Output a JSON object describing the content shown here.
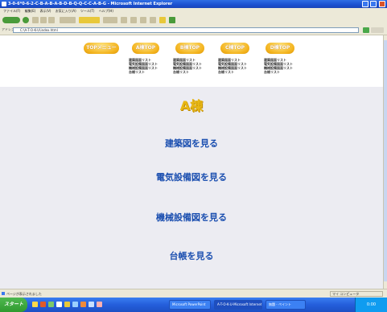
{
  "window": {
    "title": "3-0-6*0-6-2-C-B-A-B-A-B-D-B-Q-Q-C-C-A-B-G - Microsoft Internet Explorer"
  },
  "menubar": {
    "items": [
      "ファイル(F)",
      "編集(E)",
      "表示(V)",
      "お気に入り(A)",
      "ツール(T)",
      "ヘルプ(H)"
    ]
  },
  "address": {
    "label": "アドレス(D)",
    "value": "C:\\A-T-O-K-U\\index.html"
  },
  "nav": {
    "buttons": [
      {
        "label": "TOPメニュー"
      },
      {
        "label": "A棟TOP"
      },
      {
        "label": "B棟TOP"
      },
      {
        "label": "C棟TOP"
      },
      {
        "label": "D棟TOP"
      }
    ],
    "link_groups": [
      [
        "建築図面リスト",
        "電気設備図面リスト",
        "機械設備図面リスト",
        "台帳リスト"
      ],
      [
        "建築図面リスト",
        "電気設備図面リスト",
        "機械設備図面リスト",
        "台帳リスト"
      ],
      [
        "建築図面リスト",
        "電気設備図面リスト",
        "機械設備図面リスト",
        "台帳リスト"
      ],
      [
        "建築図面リスト",
        "電気設備図面リスト",
        "機械設備図面リスト",
        "台帳リスト"
      ]
    ]
  },
  "main": {
    "title": "A棟",
    "links": [
      "建築図を見る",
      "電気設備図を見る",
      "機械設備図を見る",
      "台帳を見る"
    ]
  },
  "status": {
    "text": "ページが表示されました",
    "zone": "マイ コンピュータ"
  },
  "taskbar": {
    "start": "スタート",
    "tasks": [
      "Microsoft PowerPoint",
      "A-T-O-K-U-Microsoft Internet",
      "無題 - ペイント"
    ],
    "clock": "0:00"
  },
  "colors": {
    "title_gold": "#e8b814",
    "link_blue": "#1b4fb0",
    "nav_orange": "#f3b21b"
  }
}
